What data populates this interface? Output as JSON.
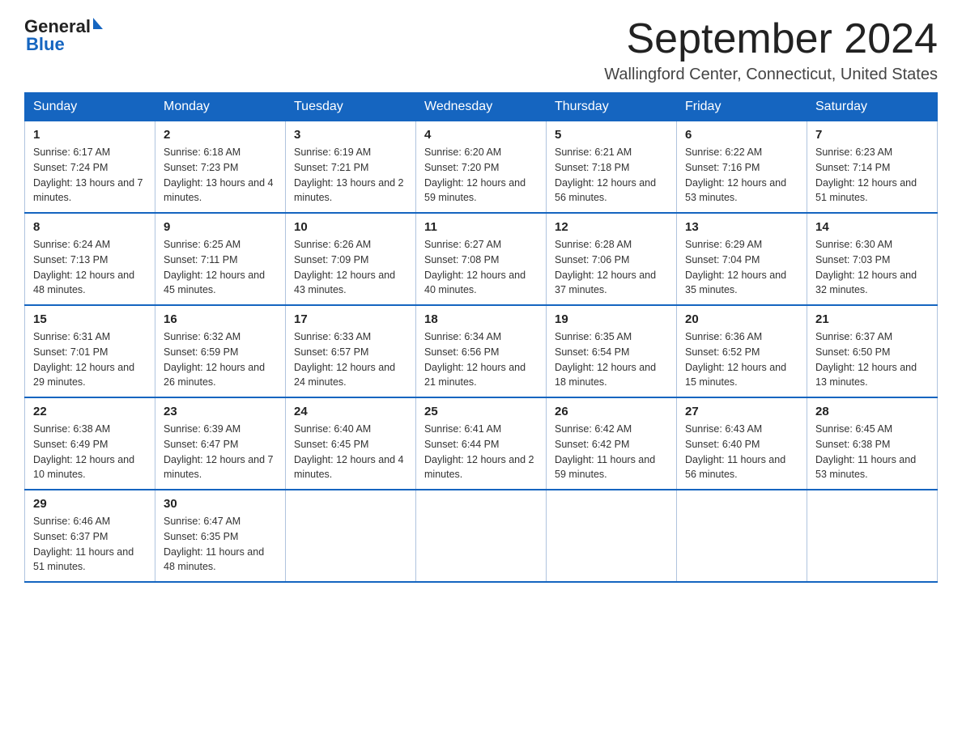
{
  "logo": {
    "text_general": "General",
    "text_blue": "Blue",
    "arrow": "▶"
  },
  "header": {
    "month_title": "September 2024",
    "subtitle": "Wallingford Center, Connecticut, United States"
  },
  "days_of_week": [
    "Sunday",
    "Monday",
    "Tuesday",
    "Wednesday",
    "Thursday",
    "Friday",
    "Saturday"
  ],
  "weeks": [
    [
      {
        "day": "1",
        "sunrise": "Sunrise: 6:17 AM",
        "sunset": "Sunset: 7:24 PM",
        "daylight": "Daylight: 13 hours and 7 minutes."
      },
      {
        "day": "2",
        "sunrise": "Sunrise: 6:18 AM",
        "sunset": "Sunset: 7:23 PM",
        "daylight": "Daylight: 13 hours and 4 minutes."
      },
      {
        "day": "3",
        "sunrise": "Sunrise: 6:19 AM",
        "sunset": "Sunset: 7:21 PM",
        "daylight": "Daylight: 13 hours and 2 minutes."
      },
      {
        "day": "4",
        "sunrise": "Sunrise: 6:20 AM",
        "sunset": "Sunset: 7:20 PM",
        "daylight": "Daylight: 12 hours and 59 minutes."
      },
      {
        "day": "5",
        "sunrise": "Sunrise: 6:21 AM",
        "sunset": "Sunset: 7:18 PM",
        "daylight": "Daylight: 12 hours and 56 minutes."
      },
      {
        "day": "6",
        "sunrise": "Sunrise: 6:22 AM",
        "sunset": "Sunset: 7:16 PM",
        "daylight": "Daylight: 12 hours and 53 minutes."
      },
      {
        "day": "7",
        "sunrise": "Sunrise: 6:23 AM",
        "sunset": "Sunset: 7:14 PM",
        "daylight": "Daylight: 12 hours and 51 minutes."
      }
    ],
    [
      {
        "day": "8",
        "sunrise": "Sunrise: 6:24 AM",
        "sunset": "Sunset: 7:13 PM",
        "daylight": "Daylight: 12 hours and 48 minutes."
      },
      {
        "day": "9",
        "sunrise": "Sunrise: 6:25 AM",
        "sunset": "Sunset: 7:11 PM",
        "daylight": "Daylight: 12 hours and 45 minutes."
      },
      {
        "day": "10",
        "sunrise": "Sunrise: 6:26 AM",
        "sunset": "Sunset: 7:09 PM",
        "daylight": "Daylight: 12 hours and 43 minutes."
      },
      {
        "day": "11",
        "sunrise": "Sunrise: 6:27 AM",
        "sunset": "Sunset: 7:08 PM",
        "daylight": "Daylight: 12 hours and 40 minutes."
      },
      {
        "day": "12",
        "sunrise": "Sunrise: 6:28 AM",
        "sunset": "Sunset: 7:06 PM",
        "daylight": "Daylight: 12 hours and 37 minutes."
      },
      {
        "day": "13",
        "sunrise": "Sunrise: 6:29 AM",
        "sunset": "Sunset: 7:04 PM",
        "daylight": "Daylight: 12 hours and 35 minutes."
      },
      {
        "day": "14",
        "sunrise": "Sunrise: 6:30 AM",
        "sunset": "Sunset: 7:03 PM",
        "daylight": "Daylight: 12 hours and 32 minutes."
      }
    ],
    [
      {
        "day": "15",
        "sunrise": "Sunrise: 6:31 AM",
        "sunset": "Sunset: 7:01 PM",
        "daylight": "Daylight: 12 hours and 29 minutes."
      },
      {
        "day": "16",
        "sunrise": "Sunrise: 6:32 AM",
        "sunset": "Sunset: 6:59 PM",
        "daylight": "Daylight: 12 hours and 26 minutes."
      },
      {
        "day": "17",
        "sunrise": "Sunrise: 6:33 AM",
        "sunset": "Sunset: 6:57 PM",
        "daylight": "Daylight: 12 hours and 24 minutes."
      },
      {
        "day": "18",
        "sunrise": "Sunrise: 6:34 AM",
        "sunset": "Sunset: 6:56 PM",
        "daylight": "Daylight: 12 hours and 21 minutes."
      },
      {
        "day": "19",
        "sunrise": "Sunrise: 6:35 AM",
        "sunset": "Sunset: 6:54 PM",
        "daylight": "Daylight: 12 hours and 18 minutes."
      },
      {
        "day": "20",
        "sunrise": "Sunrise: 6:36 AM",
        "sunset": "Sunset: 6:52 PM",
        "daylight": "Daylight: 12 hours and 15 minutes."
      },
      {
        "day": "21",
        "sunrise": "Sunrise: 6:37 AM",
        "sunset": "Sunset: 6:50 PM",
        "daylight": "Daylight: 12 hours and 13 minutes."
      }
    ],
    [
      {
        "day": "22",
        "sunrise": "Sunrise: 6:38 AM",
        "sunset": "Sunset: 6:49 PM",
        "daylight": "Daylight: 12 hours and 10 minutes."
      },
      {
        "day": "23",
        "sunrise": "Sunrise: 6:39 AM",
        "sunset": "Sunset: 6:47 PM",
        "daylight": "Daylight: 12 hours and 7 minutes."
      },
      {
        "day": "24",
        "sunrise": "Sunrise: 6:40 AM",
        "sunset": "Sunset: 6:45 PM",
        "daylight": "Daylight: 12 hours and 4 minutes."
      },
      {
        "day": "25",
        "sunrise": "Sunrise: 6:41 AM",
        "sunset": "Sunset: 6:44 PM",
        "daylight": "Daylight: 12 hours and 2 minutes."
      },
      {
        "day": "26",
        "sunrise": "Sunrise: 6:42 AM",
        "sunset": "Sunset: 6:42 PM",
        "daylight": "Daylight: 11 hours and 59 minutes."
      },
      {
        "day": "27",
        "sunrise": "Sunrise: 6:43 AM",
        "sunset": "Sunset: 6:40 PM",
        "daylight": "Daylight: 11 hours and 56 minutes."
      },
      {
        "day": "28",
        "sunrise": "Sunrise: 6:45 AM",
        "sunset": "Sunset: 6:38 PM",
        "daylight": "Daylight: 11 hours and 53 minutes."
      }
    ],
    [
      {
        "day": "29",
        "sunrise": "Sunrise: 6:46 AM",
        "sunset": "Sunset: 6:37 PM",
        "daylight": "Daylight: 11 hours and 51 minutes."
      },
      {
        "day": "30",
        "sunrise": "Sunrise: 6:47 AM",
        "sunset": "Sunset: 6:35 PM",
        "daylight": "Daylight: 11 hours and 48 minutes."
      },
      null,
      null,
      null,
      null,
      null
    ]
  ]
}
